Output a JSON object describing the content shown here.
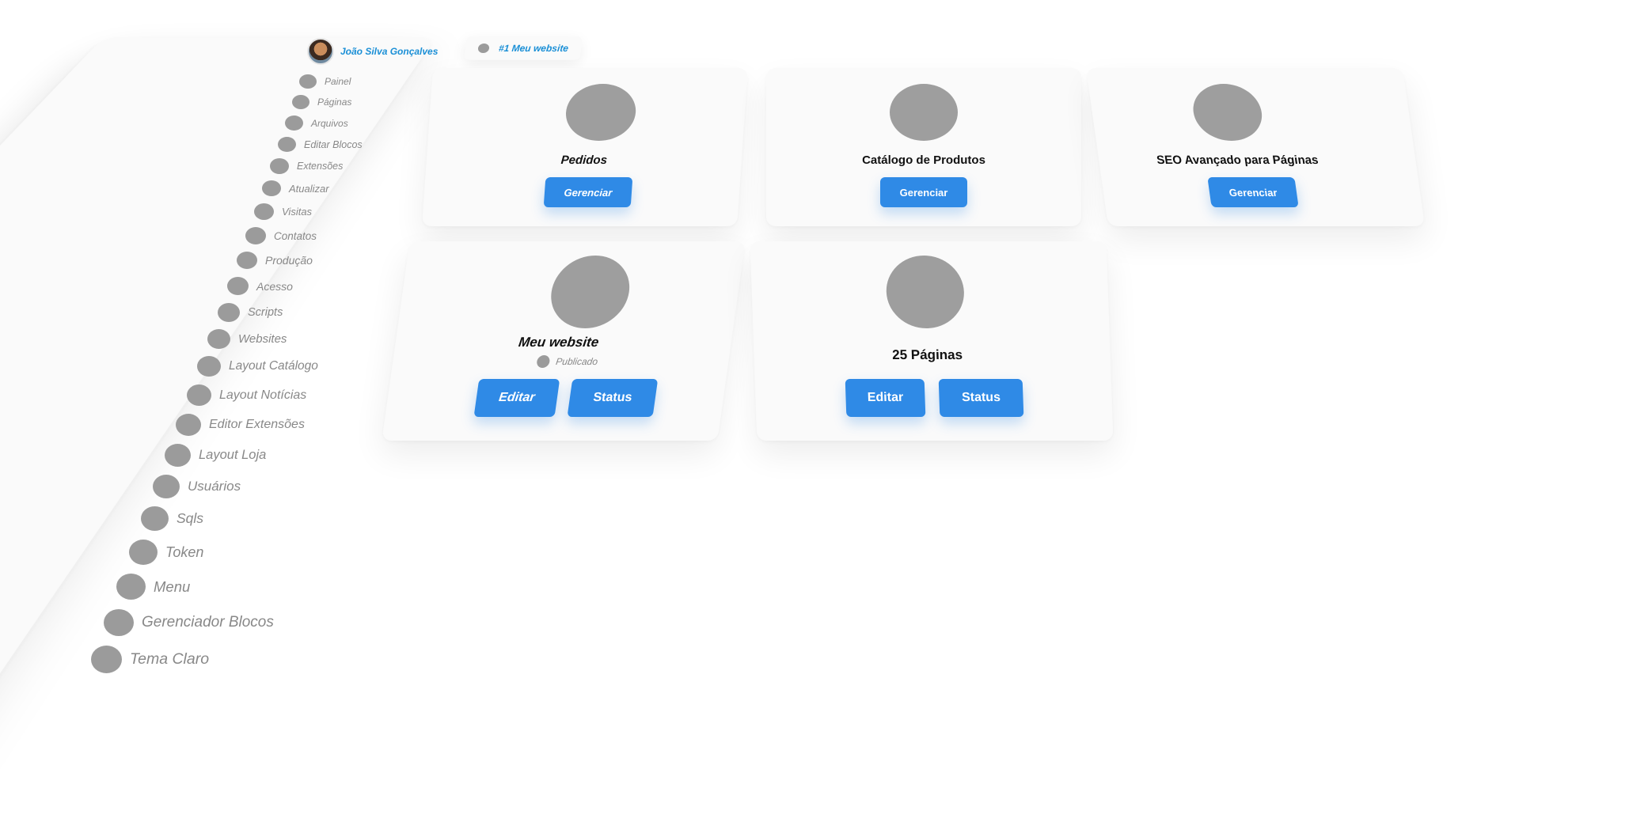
{
  "user": {
    "name": "João Silva Gonçalves"
  },
  "tab": {
    "label": "#1 Meu website"
  },
  "sidebar": {
    "items": [
      {
        "label": "Painel"
      },
      {
        "label": "Páginas"
      },
      {
        "label": "Arquivos"
      },
      {
        "label": "Editar Blocos"
      },
      {
        "label": "Extensões"
      },
      {
        "label": "Atualizar"
      },
      {
        "label": "Visitas"
      },
      {
        "label": "Contatos"
      },
      {
        "label": "Produção"
      },
      {
        "label": "Acesso"
      },
      {
        "label": "Scripts"
      },
      {
        "label": "Websites"
      },
      {
        "label": "Layout Catálogo"
      },
      {
        "label": "Layout Notícias"
      },
      {
        "label": "Editor Extensões"
      },
      {
        "label": "Layout Loja"
      },
      {
        "label": "Usuários"
      },
      {
        "label": "Sqls"
      },
      {
        "label": "Token"
      },
      {
        "label": "Menu"
      },
      {
        "label": "Gerenciador Blocos"
      },
      {
        "label": "Tema Claro"
      }
    ]
  },
  "cards": {
    "pedidos": {
      "title": "Pedidos",
      "button": "Gerenciar"
    },
    "catalogo": {
      "title": "Catálogo de Produtos",
      "button": "Gerenciar"
    },
    "seo": {
      "title": "SEO Avançado para Páginas",
      "button": "Gerenciar"
    },
    "website": {
      "title": "Meu website",
      "status": "Publicado",
      "edit": "Editar",
      "status_button": "Status"
    },
    "paginas": {
      "title": "25 Páginas",
      "edit": "Editar",
      "status_button": "Status"
    }
  },
  "colors": {
    "accent": "#2f8ae6",
    "link": "#1a8fd6",
    "placeholder": "#9e9e9e"
  }
}
